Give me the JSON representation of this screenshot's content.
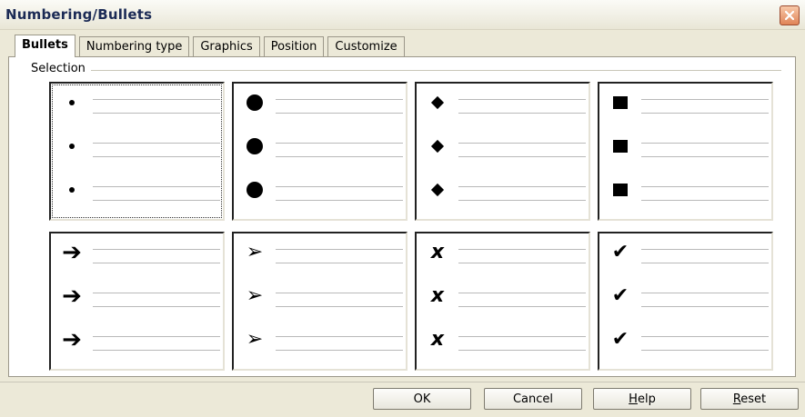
{
  "window": {
    "title": "Numbering/Bullets"
  },
  "tabs": [
    {
      "label": "Bullets",
      "active": true
    },
    {
      "label": "Numbering type",
      "active": false
    },
    {
      "label": "Graphics",
      "active": false
    },
    {
      "label": "Position",
      "active": false
    },
    {
      "label": "Customize",
      "active": false
    }
  ],
  "selection": {
    "label": "Selection",
    "styles": [
      {
        "bullet": "small-dot",
        "selected": true
      },
      {
        "bullet": "large-dot",
        "selected": false
      },
      {
        "bullet": "diamond",
        "selected": false
      },
      {
        "bullet": "square",
        "selected": false
      },
      {
        "bullet": "arrow",
        "glyph": "➔",
        "selected": false
      },
      {
        "bullet": "arrowhead",
        "glyph": "➢",
        "selected": false
      },
      {
        "bullet": "cross",
        "glyph": "x",
        "selected": false
      },
      {
        "bullet": "checkmark",
        "glyph": "✔",
        "selected": false
      }
    ]
  },
  "buttons": {
    "ok": "OK",
    "cancel": "Cancel",
    "help_first": "H",
    "help_rest": "elp",
    "reset_first": "R",
    "reset_rest": "eset"
  },
  "colors": {
    "dialog_bg": "#ece9d8",
    "title_text": "#1b2a55",
    "close_button": "#e08458"
  }
}
